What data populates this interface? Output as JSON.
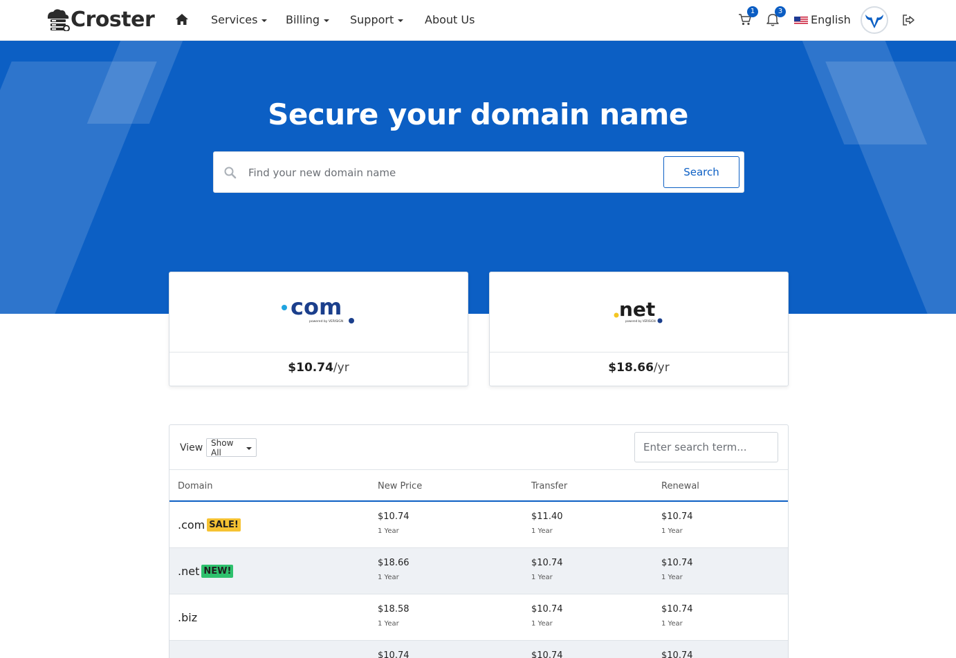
{
  "brand": {
    "name": "Croster"
  },
  "nav": {
    "items": [
      {
        "label": "Services",
        "dropdown": true
      },
      {
        "label": "Billing",
        "dropdown": true
      },
      {
        "label": "Support",
        "dropdown": true
      },
      {
        "label": "About Us",
        "dropdown": false
      }
    ],
    "cart_count": "1",
    "notification_count": "3",
    "language": "English"
  },
  "hero": {
    "title": "Secure your domain name",
    "search_placeholder": "Find your new domain name",
    "search_button": "Search"
  },
  "featured_tlds": [
    {
      "logo_text": "com",
      "powered_by": "powered by VERISIGN",
      "price": "$10.74",
      "period": "/yr"
    },
    {
      "logo_text": "net",
      "powered_by": "powered by VERISIGN",
      "price": "$18.66",
      "period": "/yr"
    }
  ],
  "pricing_table": {
    "view_label": "View",
    "view_selected": "Show All",
    "filter_placeholder": "Enter search term...",
    "columns": [
      "Domain",
      "New Price",
      "Transfer",
      "Renewal"
    ],
    "rows": [
      {
        "tld": ".com",
        "tag": "SALE!",
        "tag_type": "sale",
        "new": "$10.74",
        "new_term": "1 Year",
        "transfer": "$11.40",
        "transfer_term": "1 Year",
        "renewal": "$10.74",
        "renewal_term": "1 Year"
      },
      {
        "tld": ".net",
        "tag": "NEW!",
        "tag_type": "new",
        "new": "$18.66",
        "new_term": "1 Year",
        "transfer": "$10.74",
        "transfer_term": "1 Year",
        "renewal": "$10.74",
        "renewal_term": "1 Year"
      },
      {
        "tld": ".biz",
        "tag": "",
        "tag_type": "",
        "new": "$18.58",
        "new_term": "1 Year",
        "transfer": "$10.74",
        "transfer_term": "1 Year",
        "renewal": "$10.74",
        "renewal_term": "1 Year"
      },
      {
        "tld": "",
        "tag": "",
        "tag_type": "",
        "new": "$10.74",
        "new_term": "",
        "transfer": "$10.74",
        "transfer_term": "",
        "renewal": "$10.74",
        "renewal_term": ""
      }
    ]
  },
  "colors": {
    "primary": "#0c5fc4",
    "sale": "#f5c232",
    "new": "#2ec16d",
    "row_alt": "#eef1f5"
  }
}
